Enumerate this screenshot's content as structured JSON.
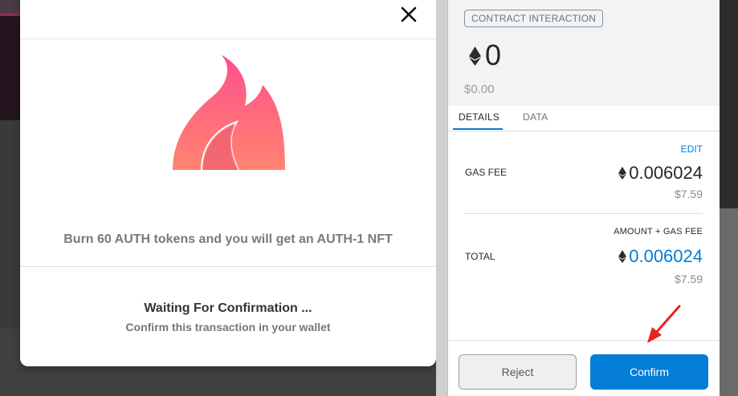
{
  "dapp_modal": {
    "burn_text": "Burn 60 AUTH tokens and you will get an AUTH-1 NFT",
    "waiting_title": "Waiting For Confirmation ...",
    "waiting_subtitle": "Confirm this transaction in your wallet",
    "close_icon": "close-icon",
    "illustration_icon": "flame-icon",
    "colors": {
      "flame_top": "#ff4f8b",
      "flame_bottom": "#ff8470"
    }
  },
  "wallet": {
    "badge": "CONTRACT INTERACTION",
    "amount": "0",
    "amount_fiat": "$0.00",
    "tabs": [
      {
        "label": "DETAILS",
        "active": true
      },
      {
        "label": "DATA",
        "active": false
      }
    ],
    "edit_label": "EDIT",
    "gas_fee": {
      "label": "GAS FEE",
      "value": "0.006024",
      "fiat": "$7.59"
    },
    "total": {
      "header": "AMOUNT + GAS FEE",
      "label": "TOTAL",
      "value": "0.006024",
      "fiat": "$7.59"
    },
    "buttons": {
      "reject": "Reject",
      "confirm": "Confirm"
    },
    "colors": {
      "accent": "#037dd6",
      "annotation_arrow": "#e8231b"
    }
  }
}
